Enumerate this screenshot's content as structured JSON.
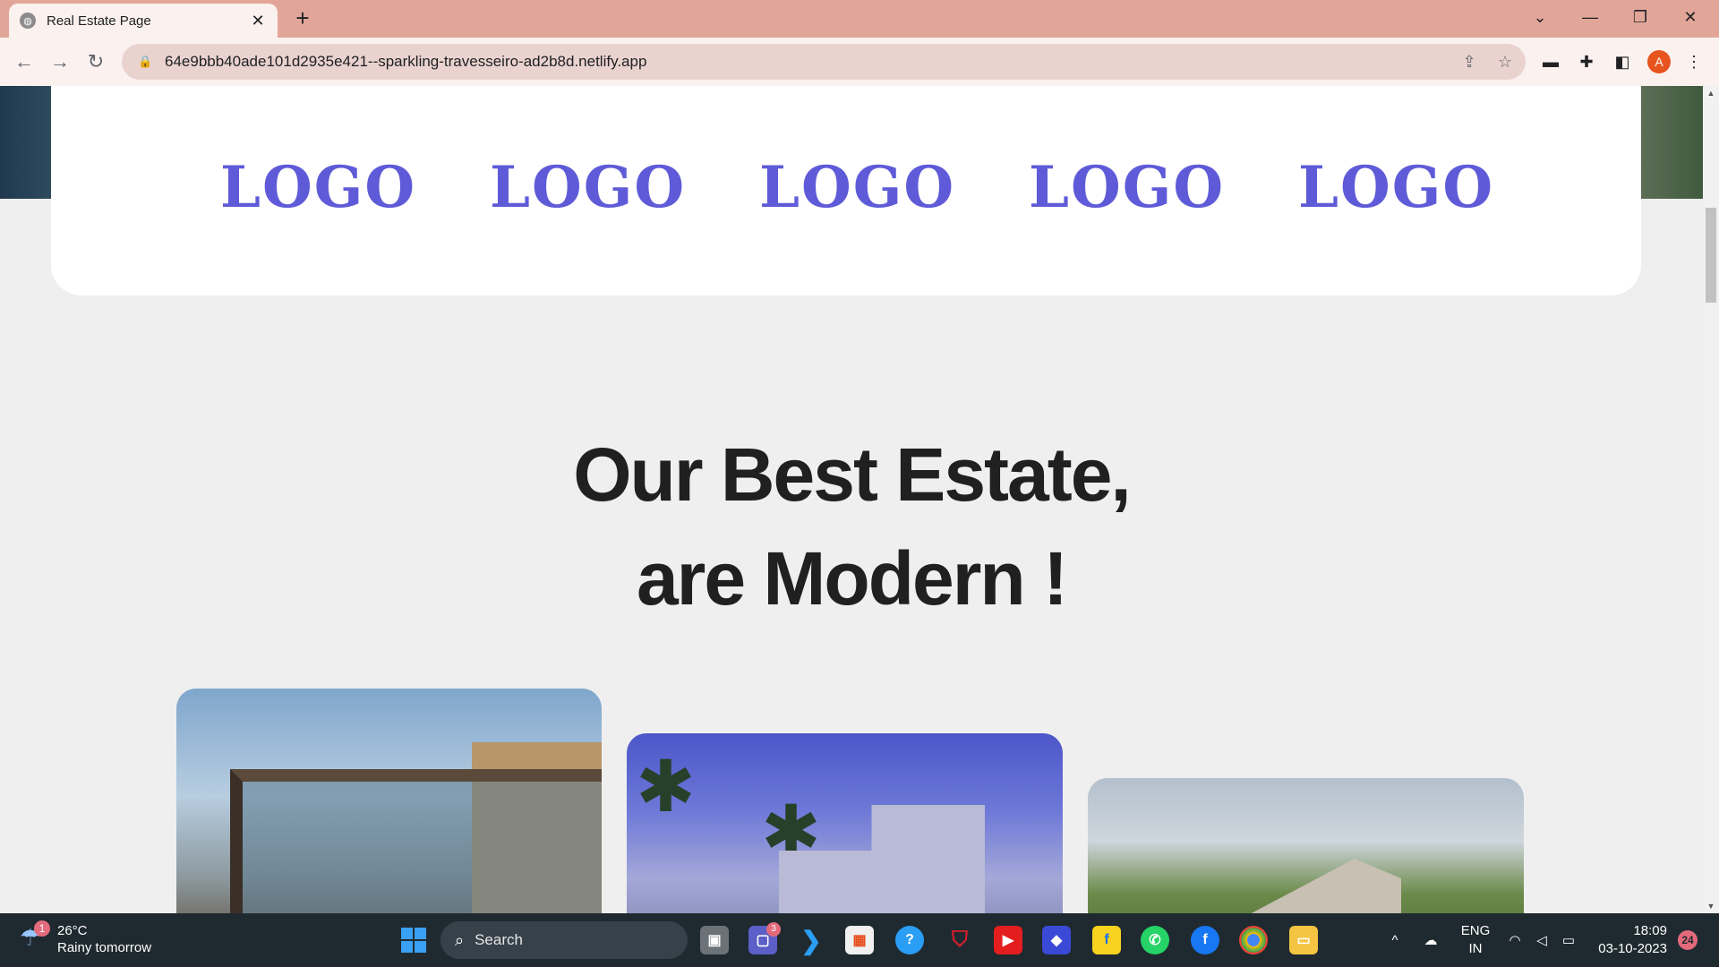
{
  "browser": {
    "tab_title": "Real Estate Page",
    "tab_close": "✕",
    "new_tab": "+",
    "url": "64e9bbb40ade101d2935e421--sparkling-travesseiro-ad2b8d.netlify.app",
    "profile_initial": "A",
    "accent": "#e2a699"
  },
  "page": {
    "logos": [
      "LOGO",
      "LOGO",
      "LOGO",
      "LOGO",
      "LOGO"
    ],
    "logo_color": "#5f5bd8",
    "headline_line1": "Our Best Estate,",
    "headline_line2": "are Modern !"
  },
  "taskbar": {
    "weather_temp": "26°C",
    "weather_desc": "Rainy tomorrow",
    "weather_badge": "1",
    "search_label": "Search",
    "teams_badge": "3",
    "lang_line1": "ENG",
    "lang_line2": "IN",
    "time": "18:09",
    "date": "03-10-2023",
    "notification_count": "24"
  }
}
